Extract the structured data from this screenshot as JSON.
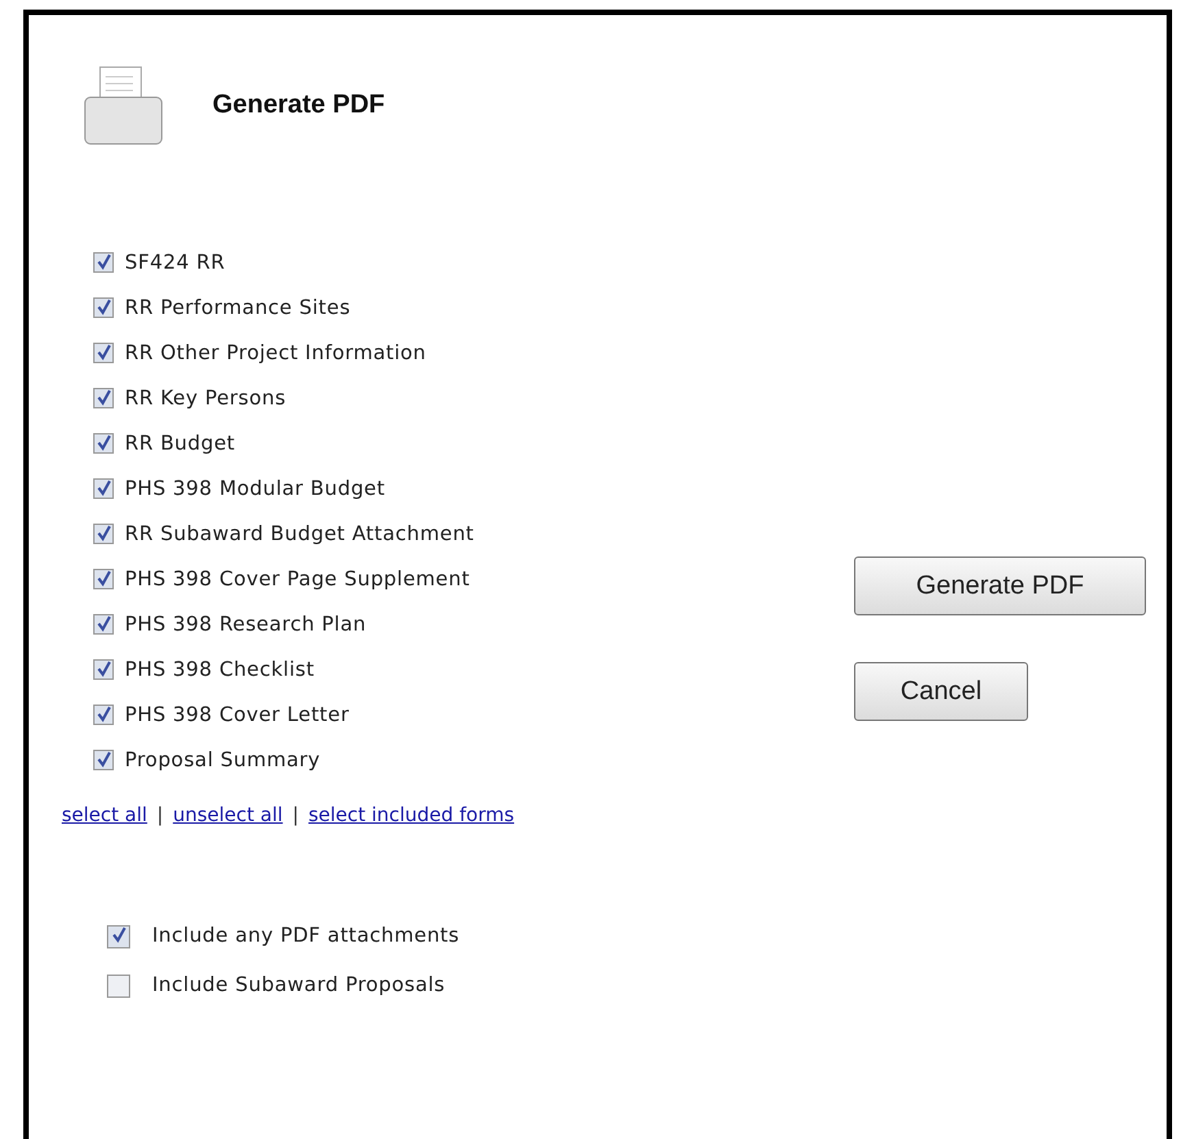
{
  "header": {
    "title": "Generate PDF"
  },
  "forms": [
    {
      "label": "SF424 RR",
      "checked": true
    },
    {
      "label": "RR Performance Sites",
      "checked": true
    },
    {
      "label": "RR Other Project Information",
      "checked": true
    },
    {
      "label": "RR Key Persons",
      "checked": true
    },
    {
      "label": "RR Budget",
      "checked": true
    },
    {
      "label": "PHS 398 Modular Budget",
      "checked": true
    },
    {
      "label": "RR Subaward Budget Attachment",
      "checked": true
    },
    {
      "label": "PHS 398 Cover Page Supplement",
      "checked": true
    },
    {
      "label": "PHS 398 Research Plan",
      "checked": true
    },
    {
      "label": "PHS 398 Checklist",
      "checked": true
    },
    {
      "label": "PHS 398 Cover Letter",
      "checked": true
    },
    {
      "label": "Proposal Summary",
      "checked": true
    }
  ],
  "buttons": [
    "Generate PDF",
    "Cancel"
  ],
  "links": [
    "select all",
    "unselect all",
    "select included forms"
  ],
  "link_separator": "|",
  "options": [
    {
      "label": "Include any PDF attachments",
      "checked": true
    },
    {
      "label": "Include Subaward Proposals",
      "checked": false
    }
  ]
}
